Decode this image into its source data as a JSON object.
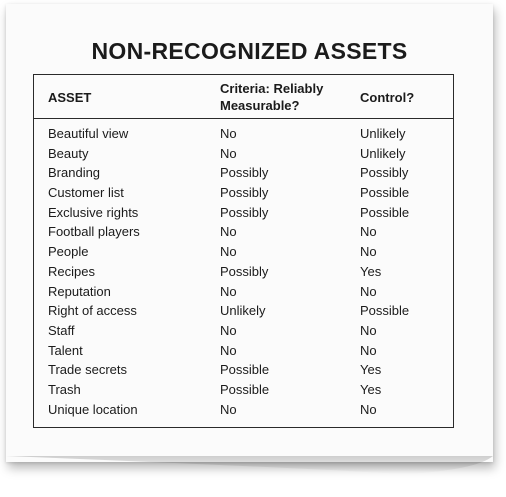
{
  "title": "NON-RECOGNIZED ASSETS",
  "columns": {
    "asset": "ASSET",
    "criteria_line1": "Criteria: Reliably",
    "criteria_line2": "Measurable?",
    "control": "Control?"
  },
  "rows": [
    {
      "asset": "Beautiful view",
      "criteria": "No",
      "control": "Unlikely"
    },
    {
      "asset": "Beauty",
      "criteria": "No",
      "control": "Unlikely"
    },
    {
      "asset": "Branding",
      "criteria": "Possibly",
      "control": "Possibly"
    },
    {
      "asset": "Customer list",
      "criteria": "Possibly",
      "control": "Possible"
    },
    {
      "asset": "Exclusive rights",
      "criteria": "Possibly",
      "control": "Possible"
    },
    {
      "asset": "Football players",
      "criteria": "No",
      "control": "No"
    },
    {
      "asset": "People",
      "criteria": "No",
      "control": "No"
    },
    {
      "asset": "Recipes",
      "criteria": "Possibly",
      "control": "Yes"
    },
    {
      "asset": "Reputation",
      "criteria": "No",
      "control": "No"
    },
    {
      "asset": "Right of access",
      "criteria": "Unlikely",
      "control": "Possible"
    },
    {
      "asset": "Staff",
      "criteria": "No",
      "control": "No"
    },
    {
      "asset": "Talent",
      "criteria": "No",
      "control": "No"
    },
    {
      "asset": "Trade secrets",
      "criteria": "Possible",
      "control": "Yes"
    },
    {
      "asset": "Trash",
      "criteria": "Possible",
      "control": "Yes"
    },
    {
      "asset": "Unique location",
      "criteria": "No",
      "control": "No"
    }
  ]
}
